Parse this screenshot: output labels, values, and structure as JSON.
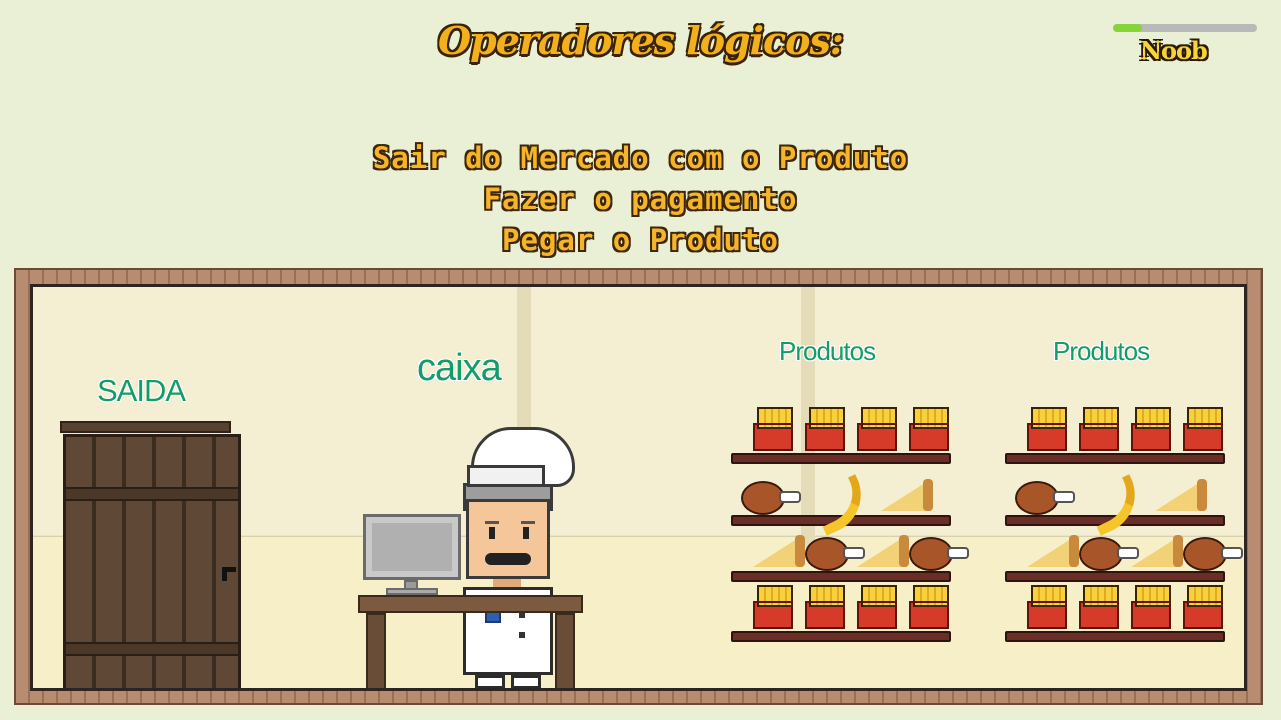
{
  "header": {
    "title": "Operadores lógicos:"
  },
  "level": {
    "label": "Noob",
    "progress_fraction": 0.2,
    "bar_color": "#84d43a",
    "track_color": "#b9b9b9"
  },
  "steps": [
    "Sair do Mercado com o Produto",
    "Fazer o pagamento",
    "Pegar o Produto"
  ],
  "scene": {
    "exit_label": "SAIDA",
    "cashier_label": "caixa",
    "shelves": [
      {
        "label": "Produtos",
        "rows": [
          [
            "fries-icon",
            "fries-icon",
            "fries-icon",
            "fries-icon"
          ],
          [
            "chicken-leg-icon",
            "banana-icon",
            "pizza-slice-icon"
          ],
          [
            "pizza-slice-icon",
            "chicken-leg-icon",
            "pizza-slice-icon",
            "chicken-leg-icon"
          ],
          [
            "fries-icon",
            "fries-icon",
            "fries-icon",
            "fries-icon"
          ]
        ]
      },
      {
        "label": "Produtos",
        "rows": [
          [
            "fries-icon",
            "fries-icon",
            "fries-icon",
            "fries-icon"
          ],
          [
            "chicken-leg-icon",
            "banana-icon",
            "pizza-slice-icon"
          ],
          [
            "pizza-slice-icon",
            "chicken-leg-icon",
            "pizza-slice-icon",
            "chicken-leg-icon"
          ],
          [
            "fries-icon",
            "fries-icon",
            "fries-icon",
            "fries-icon"
          ]
        ]
      }
    ]
  },
  "colors": {
    "background": "#e9f0d6",
    "title_fill": "#f2b01c",
    "label_green": "#149b6b"
  }
}
